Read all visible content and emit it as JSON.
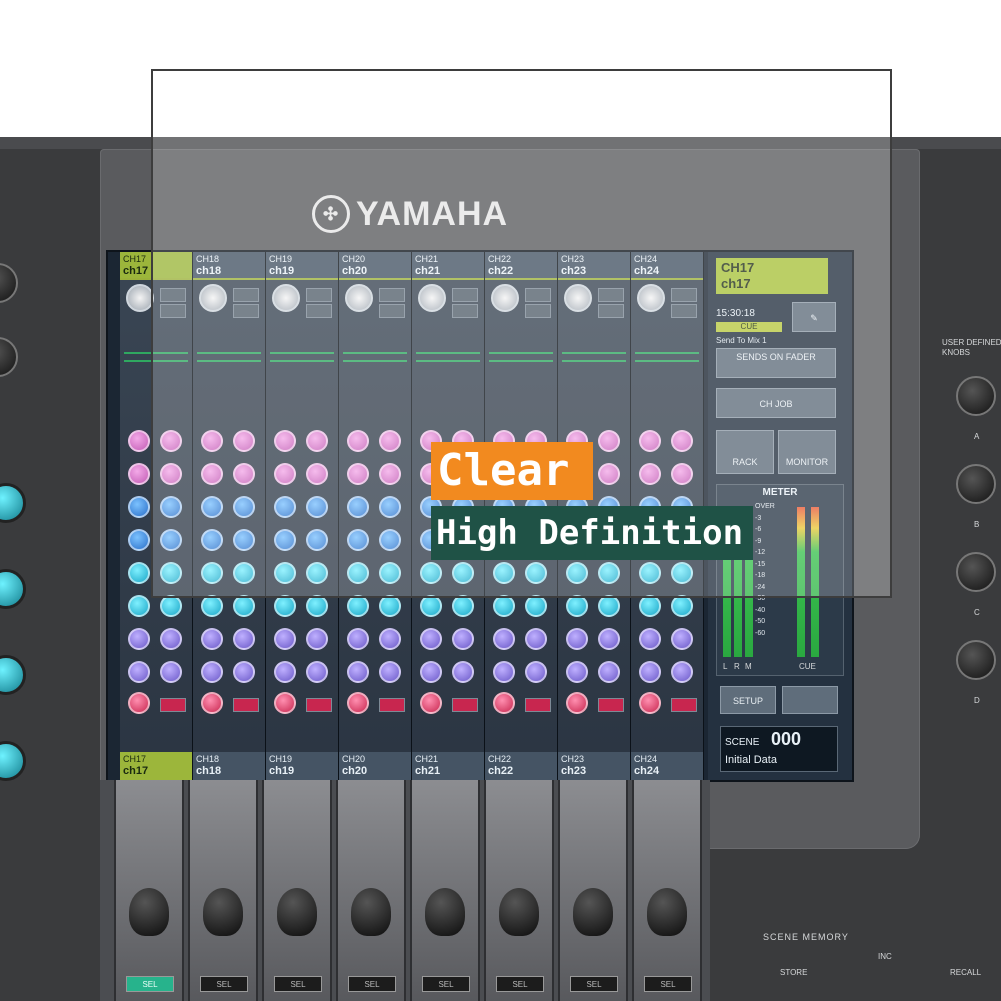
{
  "brand": {
    "name": "YAMAHA"
  },
  "channels": [
    {
      "num": "CH17",
      "name": "ch17",
      "selected": true
    },
    {
      "num": "CH18",
      "name": "ch18",
      "selected": false
    },
    {
      "num": "CH19",
      "name": "ch19",
      "selected": false
    },
    {
      "num": "CH20",
      "name": "ch20",
      "selected": false
    },
    {
      "num": "CH21",
      "name": "ch21",
      "selected": false
    },
    {
      "num": "CH22",
      "name": "ch22",
      "selected": false
    },
    {
      "num": "CH23",
      "name": "ch23",
      "selected": false
    },
    {
      "num": "CH24",
      "name": "ch24",
      "selected": false
    }
  ],
  "side_panel": {
    "ch_display": {
      "line1": "CH17",
      "line2": "ch17"
    },
    "clock": "15:30:18",
    "clock_bar": "CUE",
    "send_to": "Send To Mix 1",
    "sends_on_fader": "SENDS ON FADER",
    "ch_job": "CH JOB",
    "rack": "RACK",
    "monitor": "MONITOR",
    "meter_title": "METER",
    "meter_scale": [
      "OVER",
      "-3",
      "-6",
      "-9",
      "-12",
      "-15",
      "-18",
      "-24",
      "-30",
      "-40",
      "-50",
      "-60"
    ],
    "meter_labels": [
      "L",
      "R",
      "M",
      "CUE"
    ],
    "setup": "SETUP",
    "scene_label": "SCENE",
    "scene_number": "000",
    "scene_name": "Initial Data"
  },
  "right_panel": {
    "title": "USER DEFINED KNOBS",
    "knobs": [
      "A",
      "B",
      "C",
      "D"
    ]
  },
  "bottom": {
    "sel_label": "SEL",
    "scene_memory": "SCENE MEMORY",
    "store": "STORE",
    "recall": "RECALL",
    "inc": "INC"
  },
  "overlay": {
    "badge1": "Clear",
    "badge2": "High Definition"
  },
  "colors": {
    "accent_green": "#9cb63b",
    "badge_orange": "#f28a1f",
    "badge_teal": "#1f5246"
  }
}
